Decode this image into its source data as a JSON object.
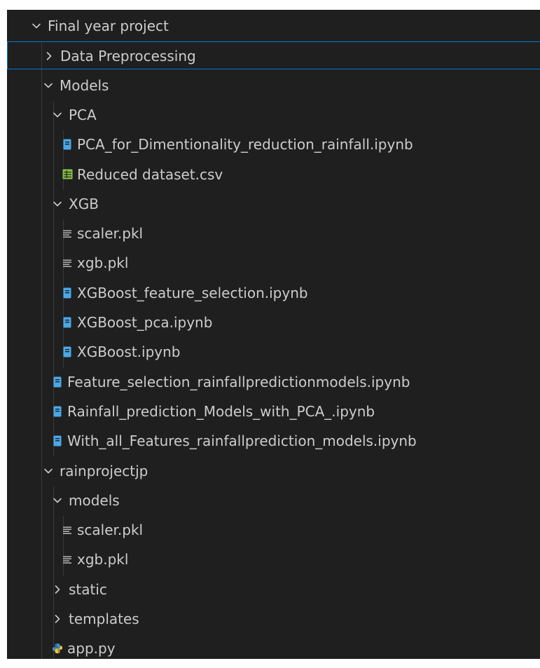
{
  "explorer": {
    "items": [
      {
        "label": "Final year project",
        "kind": "folder",
        "expanded": true,
        "depth": 0
      },
      {
        "label": "Data Preprocessing",
        "kind": "folder",
        "expanded": false,
        "depth": 1,
        "selected": true
      },
      {
        "label": "Models",
        "kind": "folder",
        "expanded": true,
        "depth": 1
      },
      {
        "label": "PCA",
        "kind": "folder",
        "expanded": true,
        "depth": 2
      },
      {
        "label": "PCA_for_Dimentionality_reduction_rainfall.ipynb",
        "kind": "notebook",
        "depth": 3
      },
      {
        "label": "Reduced dataset.csv",
        "kind": "csv",
        "depth": 3
      },
      {
        "label": "XGB",
        "kind": "folder",
        "expanded": true,
        "depth": 2
      },
      {
        "label": "scaler.pkl",
        "kind": "text",
        "depth": 3
      },
      {
        "label": "xgb.pkl",
        "kind": "text",
        "depth": 3
      },
      {
        "label": "XGBoost_feature_selection.ipynb",
        "kind": "notebook",
        "depth": 3
      },
      {
        "label": "XGBoost_pca.ipynb",
        "kind": "notebook",
        "depth": 3
      },
      {
        "label": "XGBoost.ipynb",
        "kind": "notebook",
        "depth": 3
      },
      {
        "label": "Feature_selection_rainfallpredictionmodels.ipynb",
        "kind": "notebook",
        "depth": 2
      },
      {
        "label": "Rainfall_prediction_Models_with_PCA_.ipynb",
        "kind": "notebook",
        "depth": 2
      },
      {
        "label": "With_all_Features_rainfallprediction_models.ipynb",
        "kind": "notebook",
        "depth": 2
      },
      {
        "label": "rainprojectjp",
        "kind": "folder",
        "expanded": true,
        "depth": 1
      },
      {
        "label": "models",
        "kind": "folder",
        "expanded": true,
        "depth": 2
      },
      {
        "label": "scaler.pkl",
        "kind": "text",
        "depth": 3
      },
      {
        "label": "xgb.pkl",
        "kind": "text",
        "depth": 3
      },
      {
        "label": "static",
        "kind": "folder",
        "expanded": false,
        "depth": 2
      },
      {
        "label": "templates",
        "kind": "folder",
        "expanded": false,
        "depth": 2
      },
      {
        "label": "app.py",
        "kind": "python",
        "depth": 2
      }
    ]
  },
  "colors": {
    "panel_bg": "#1f1f1f",
    "text": "#cccccc",
    "selection_border": "#0078d4",
    "notebook_icon": "#4aa8e8",
    "csv_icon": "#8bc34a",
    "python_icon_blue": "#3b8ed0",
    "python_icon_yellow": "#f2c744"
  },
  "icon_names": {
    "folder_expanded": "chevron-down-icon",
    "folder_collapsed": "chevron-right-icon",
    "notebook": "notebook-icon",
    "csv": "csv-table-icon",
    "text": "text-lines-icon",
    "python": "python-icon"
  }
}
